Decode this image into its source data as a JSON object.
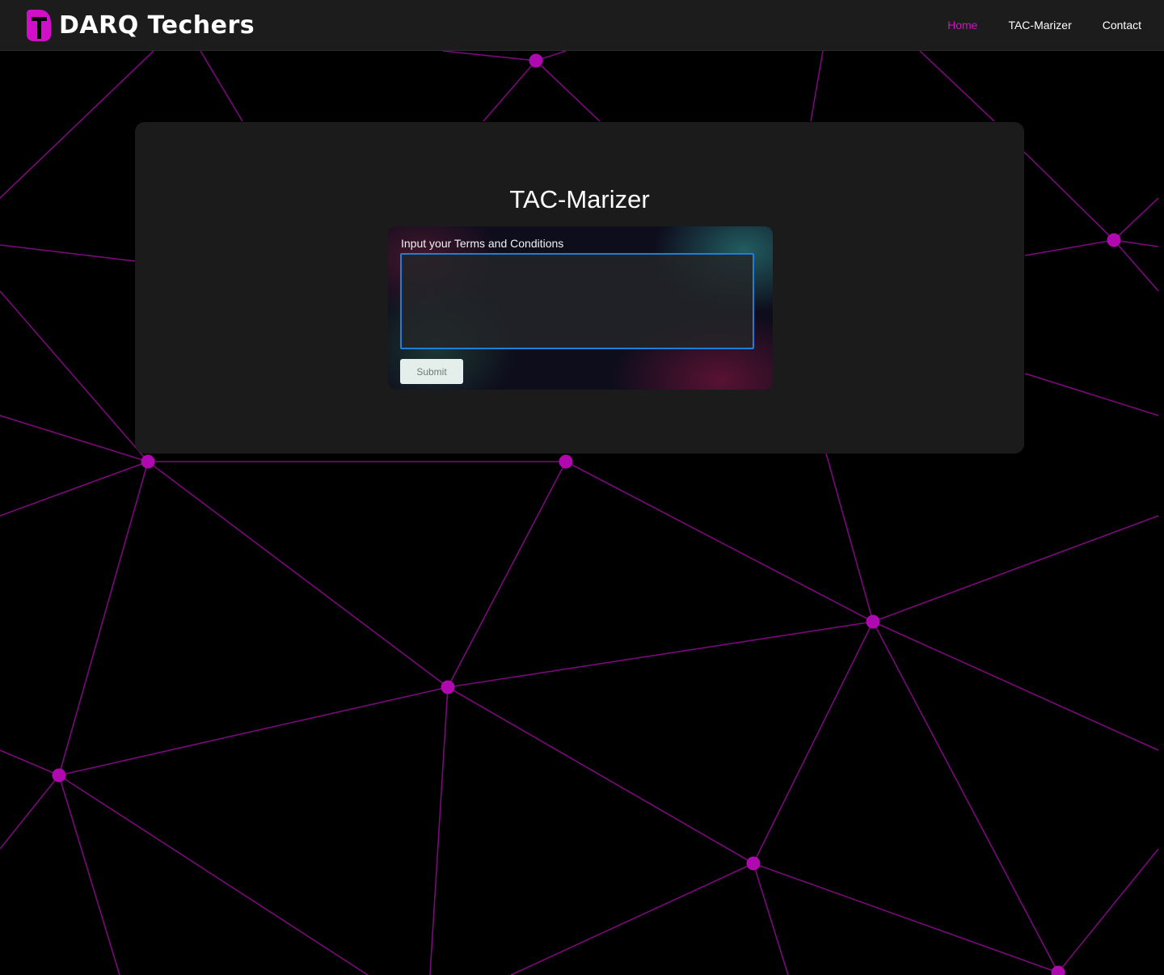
{
  "header": {
    "brand_name": "DARQ Techers",
    "logo_icon": "darq-t-logo",
    "nav": [
      {
        "label": "Home",
        "active": true
      },
      {
        "label": "TAC-Marizer",
        "active": false
      },
      {
        "label": "Contact",
        "active": false
      }
    ]
  },
  "main": {
    "title": "TAC-Marizer",
    "form": {
      "label": "Input your Terms and Conditions",
      "textarea_value": "",
      "textarea_placeholder": "",
      "submit_label": "Submit"
    }
  },
  "theme": {
    "accent": "#d10fc9",
    "network_line": "#7a0a7a",
    "network_node": "#b009b0",
    "background": "#000000",
    "panel": "#1b1b1b",
    "navbar": "#1c1c1c",
    "focus_border": "#1d7fd8"
  }
}
